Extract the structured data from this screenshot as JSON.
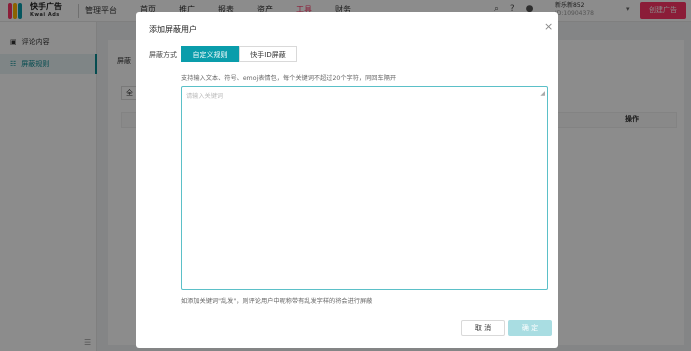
{
  "brand": {
    "name": "快手广告",
    "sub": "Kwai Ads",
    "platform": "管理平台"
  },
  "nav": [
    "首页",
    "推广",
    "报表",
    "资产",
    "工具",
    "财务"
  ],
  "nav_active_index": 4,
  "account": {
    "name": "新乐新852",
    "id": "ID:10904378"
  },
  "create_ad_label": "创建广告",
  "sidebar": {
    "items": [
      {
        "icon": "comment-icon",
        "label": "评论内容"
      },
      {
        "icon": "rule-icon",
        "label": "屏蔽规则"
      }
    ]
  },
  "background": {
    "label": "屏蔽",
    "input_value": "全",
    "table_op": "操作"
  },
  "modal": {
    "title": "添加屏蔽用户",
    "shield_label": "屏蔽方式",
    "tabs": [
      "自定义规则",
      "快手ID屏蔽"
    ],
    "hint": "支持输入文本、符号、emoj表情包，每个关键词不超过20个字符，同回车隔开",
    "placeholder": "请输入关键词",
    "example": "如添加关键词\"乱发\"，则评论用户中昵称带有乱发字样的将会进行屏蔽",
    "cancel": "取 消",
    "ok": "确 定"
  },
  "colors": {
    "accent": "#0a9dab",
    "brand_red": "#fe3666"
  }
}
